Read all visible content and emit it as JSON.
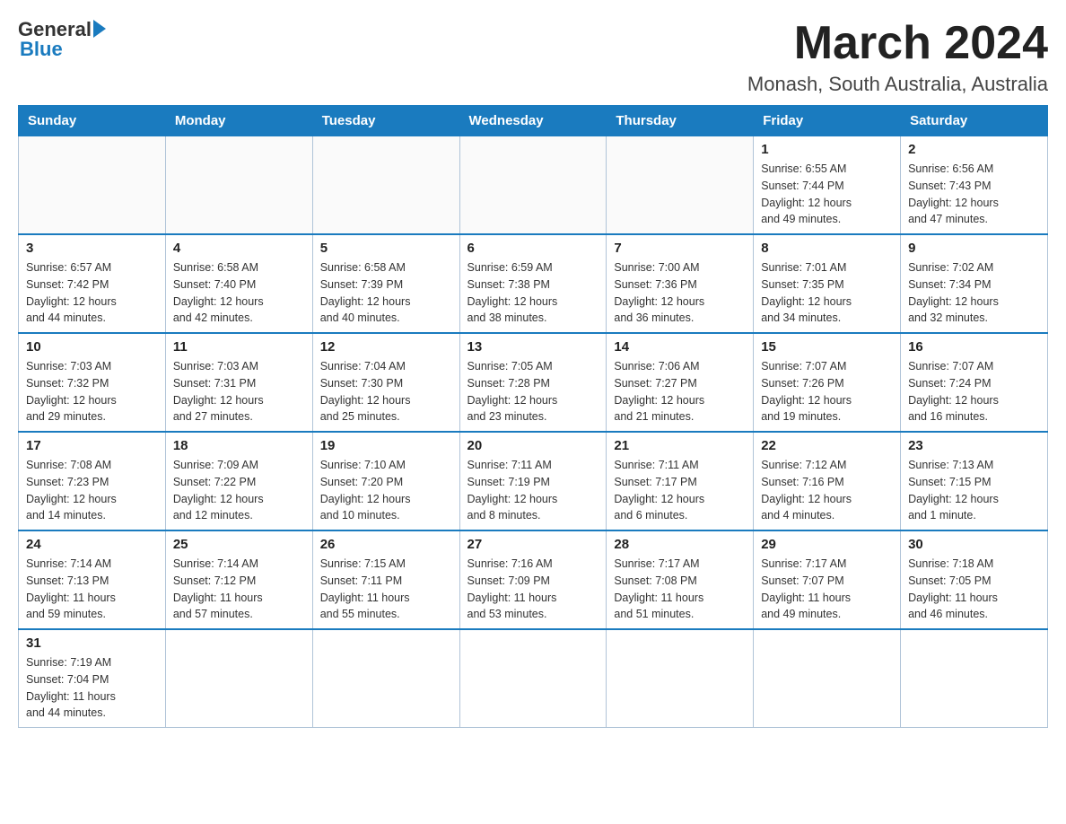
{
  "logo": {
    "part1": "General",
    "part2": "Blue"
  },
  "title": "March 2024",
  "subtitle": "Monash, South Australia, Australia",
  "weekdays": [
    "Sunday",
    "Monday",
    "Tuesday",
    "Wednesday",
    "Thursday",
    "Friday",
    "Saturday"
  ],
  "weeks": [
    [
      {
        "day": "",
        "info": ""
      },
      {
        "day": "",
        "info": ""
      },
      {
        "day": "",
        "info": ""
      },
      {
        "day": "",
        "info": ""
      },
      {
        "day": "",
        "info": ""
      },
      {
        "day": "1",
        "info": "Sunrise: 6:55 AM\nSunset: 7:44 PM\nDaylight: 12 hours\nand 49 minutes."
      },
      {
        "day": "2",
        "info": "Sunrise: 6:56 AM\nSunset: 7:43 PM\nDaylight: 12 hours\nand 47 minutes."
      }
    ],
    [
      {
        "day": "3",
        "info": "Sunrise: 6:57 AM\nSunset: 7:42 PM\nDaylight: 12 hours\nand 44 minutes."
      },
      {
        "day": "4",
        "info": "Sunrise: 6:58 AM\nSunset: 7:40 PM\nDaylight: 12 hours\nand 42 minutes."
      },
      {
        "day": "5",
        "info": "Sunrise: 6:58 AM\nSunset: 7:39 PM\nDaylight: 12 hours\nand 40 minutes."
      },
      {
        "day": "6",
        "info": "Sunrise: 6:59 AM\nSunset: 7:38 PM\nDaylight: 12 hours\nand 38 minutes."
      },
      {
        "day": "7",
        "info": "Sunrise: 7:00 AM\nSunset: 7:36 PM\nDaylight: 12 hours\nand 36 minutes."
      },
      {
        "day": "8",
        "info": "Sunrise: 7:01 AM\nSunset: 7:35 PM\nDaylight: 12 hours\nand 34 minutes."
      },
      {
        "day": "9",
        "info": "Sunrise: 7:02 AM\nSunset: 7:34 PM\nDaylight: 12 hours\nand 32 minutes."
      }
    ],
    [
      {
        "day": "10",
        "info": "Sunrise: 7:03 AM\nSunset: 7:32 PM\nDaylight: 12 hours\nand 29 minutes."
      },
      {
        "day": "11",
        "info": "Sunrise: 7:03 AM\nSunset: 7:31 PM\nDaylight: 12 hours\nand 27 minutes."
      },
      {
        "day": "12",
        "info": "Sunrise: 7:04 AM\nSunset: 7:30 PM\nDaylight: 12 hours\nand 25 minutes."
      },
      {
        "day": "13",
        "info": "Sunrise: 7:05 AM\nSunset: 7:28 PM\nDaylight: 12 hours\nand 23 minutes."
      },
      {
        "day": "14",
        "info": "Sunrise: 7:06 AM\nSunset: 7:27 PM\nDaylight: 12 hours\nand 21 minutes."
      },
      {
        "day": "15",
        "info": "Sunrise: 7:07 AM\nSunset: 7:26 PM\nDaylight: 12 hours\nand 19 minutes."
      },
      {
        "day": "16",
        "info": "Sunrise: 7:07 AM\nSunset: 7:24 PM\nDaylight: 12 hours\nand 16 minutes."
      }
    ],
    [
      {
        "day": "17",
        "info": "Sunrise: 7:08 AM\nSunset: 7:23 PM\nDaylight: 12 hours\nand 14 minutes."
      },
      {
        "day": "18",
        "info": "Sunrise: 7:09 AM\nSunset: 7:22 PM\nDaylight: 12 hours\nand 12 minutes."
      },
      {
        "day": "19",
        "info": "Sunrise: 7:10 AM\nSunset: 7:20 PM\nDaylight: 12 hours\nand 10 minutes."
      },
      {
        "day": "20",
        "info": "Sunrise: 7:11 AM\nSunset: 7:19 PM\nDaylight: 12 hours\nand 8 minutes."
      },
      {
        "day": "21",
        "info": "Sunrise: 7:11 AM\nSunset: 7:17 PM\nDaylight: 12 hours\nand 6 minutes."
      },
      {
        "day": "22",
        "info": "Sunrise: 7:12 AM\nSunset: 7:16 PM\nDaylight: 12 hours\nand 4 minutes."
      },
      {
        "day": "23",
        "info": "Sunrise: 7:13 AM\nSunset: 7:15 PM\nDaylight: 12 hours\nand 1 minute."
      }
    ],
    [
      {
        "day": "24",
        "info": "Sunrise: 7:14 AM\nSunset: 7:13 PM\nDaylight: 11 hours\nand 59 minutes."
      },
      {
        "day": "25",
        "info": "Sunrise: 7:14 AM\nSunset: 7:12 PM\nDaylight: 11 hours\nand 57 minutes."
      },
      {
        "day": "26",
        "info": "Sunrise: 7:15 AM\nSunset: 7:11 PM\nDaylight: 11 hours\nand 55 minutes."
      },
      {
        "day": "27",
        "info": "Sunrise: 7:16 AM\nSunset: 7:09 PM\nDaylight: 11 hours\nand 53 minutes."
      },
      {
        "day": "28",
        "info": "Sunrise: 7:17 AM\nSunset: 7:08 PM\nDaylight: 11 hours\nand 51 minutes."
      },
      {
        "day": "29",
        "info": "Sunrise: 7:17 AM\nSunset: 7:07 PM\nDaylight: 11 hours\nand 49 minutes."
      },
      {
        "day": "30",
        "info": "Sunrise: 7:18 AM\nSunset: 7:05 PM\nDaylight: 11 hours\nand 46 minutes."
      }
    ],
    [
      {
        "day": "31",
        "info": "Sunrise: 7:19 AM\nSunset: 7:04 PM\nDaylight: 11 hours\nand 44 minutes."
      },
      {
        "day": "",
        "info": ""
      },
      {
        "day": "",
        "info": ""
      },
      {
        "day": "",
        "info": ""
      },
      {
        "day": "",
        "info": ""
      },
      {
        "day": "",
        "info": ""
      },
      {
        "day": "",
        "info": ""
      }
    ]
  ]
}
